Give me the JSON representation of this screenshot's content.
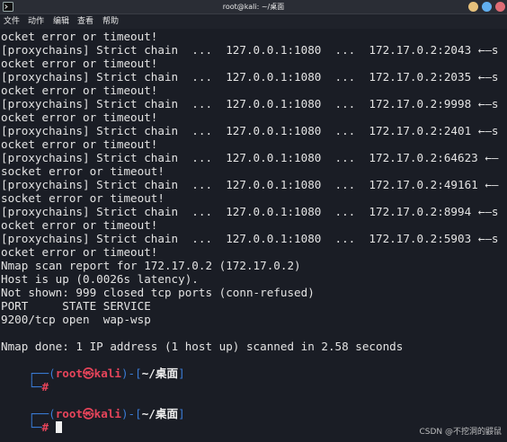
{
  "window": {
    "title": "root@kali: ~/桌面",
    "colors": {
      "minimize": "#e5c07b",
      "maximize": "#61afef",
      "close": "#e06c75"
    }
  },
  "menu": {
    "items": [
      "文件",
      "动作",
      "编辑",
      "查看",
      "帮助"
    ]
  },
  "terminal": {
    "lines": [
      "ocket error or timeout!",
      "[proxychains] Strict chain  ...  127.0.0.1:1080  ...  172.17.0.2:2043 ←—s",
      "ocket error or timeout!",
      "[proxychains] Strict chain  ...  127.0.0.1:1080  ...  172.17.0.2:2035 ←—s",
      "ocket error or timeout!",
      "[proxychains] Strict chain  ...  127.0.0.1:1080  ...  172.17.0.2:9998 ←—s",
      "ocket error or timeout!",
      "[proxychains] Strict chain  ...  127.0.0.1:1080  ...  172.17.0.2:2401 ←—s",
      "ocket error or timeout!",
      "[proxychains] Strict chain  ...  127.0.0.1:1080  ...  172.17.0.2:64623 ←—",
      "socket error or timeout!",
      "[proxychains] Strict chain  ...  127.0.0.1:1080  ...  172.17.0.2:49161 ←—",
      "socket error or timeout!",
      "[proxychains] Strict chain  ...  127.0.0.1:1080  ...  172.17.0.2:8994 ←—s",
      "ocket error or timeout!",
      "[proxychains] Strict chain  ...  127.0.0.1:1080  ...  172.17.0.2:5903 ←—s",
      "ocket error or timeout!",
      "Nmap scan report for 172.17.0.2 (172.17.0.2)",
      "Host is up (0.0026s latency).",
      "Not shown: 999 closed tcp ports (conn-refused)",
      "PORT     STATE SERVICE",
      "9200/tcp open  wap-wsp",
      "",
      "Nmap done: 1 IP address (1 host up) scanned in 2.58 seconds"
    ],
    "prompts": [
      {
        "user": "root",
        "at": "㉿",
        "host": "kali",
        "path": "~/桌面",
        "symbol": "#",
        "command": ""
      },
      {
        "user": "root",
        "at": "㉿",
        "host": "kali",
        "path": "~/桌面",
        "symbol": "#",
        "command": ""
      }
    ]
  },
  "watermark": "CSDN @不挖洞的鼹鼠"
}
